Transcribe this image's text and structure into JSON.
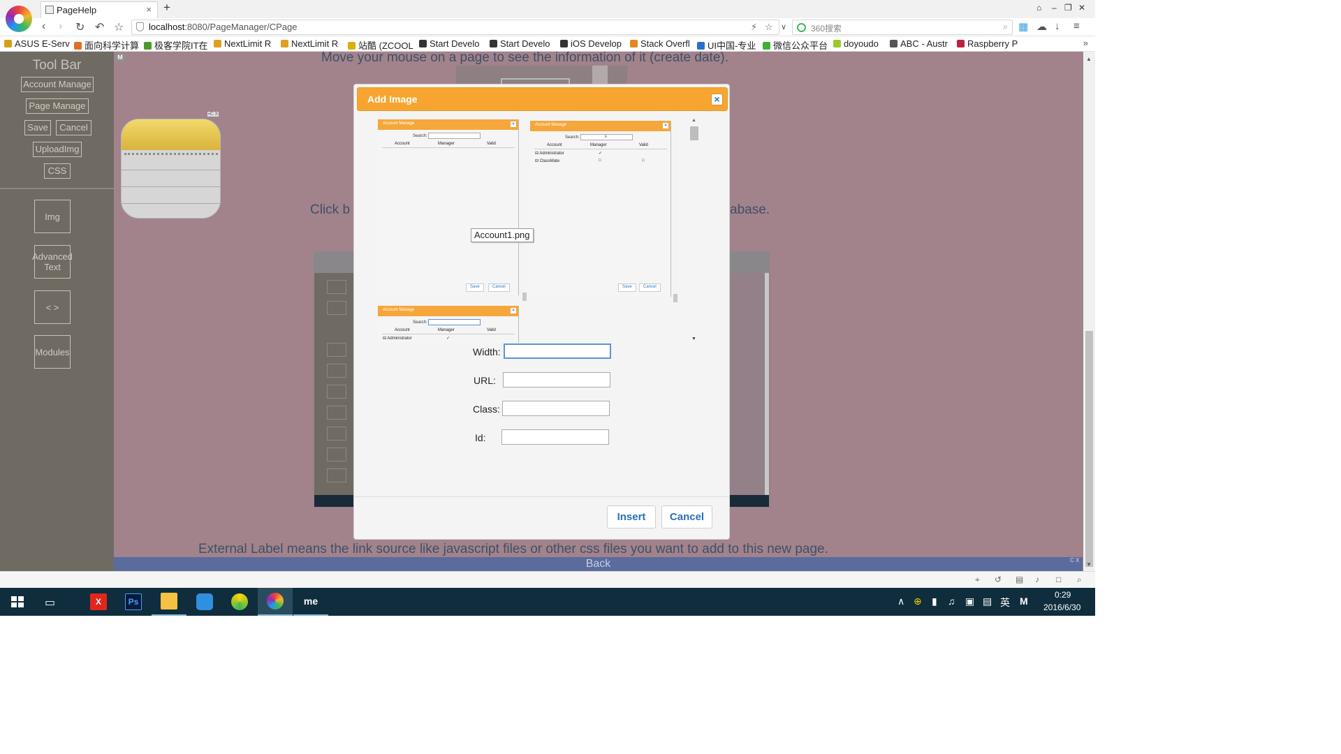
{
  "browser": {
    "tab_title": "PageHelp",
    "tab_close": "×",
    "new_tab": "+",
    "url_host": "localhost",
    "url_path": ":8080/PageManager/CPage",
    "search_placeholder": "360搜索",
    "window_controls": [
      "⌂",
      "–",
      "❐",
      "✕"
    ]
  },
  "bookmarks": [
    {
      "label": "ASUS E-Serv",
      "color": "#d4a017"
    },
    {
      "label": "面向科学计算",
      "color": "#e07020"
    },
    {
      "label": "极客学院IT在",
      "color": "#4a9a2a"
    },
    {
      "label": "NextLimit R",
      "color": "#e0a020"
    },
    {
      "label": "NextLimit R",
      "color": "#e0a020"
    },
    {
      "label": "站酷 (ZCOOL",
      "color": "#e0b000"
    },
    {
      "label": "Start Develo",
      "color": "#333333"
    },
    {
      "label": "Start Develo",
      "color": "#333333"
    },
    {
      "label": "iOS Develop",
      "color": "#333333"
    },
    {
      "label": "Stack Overfl",
      "color": "#e08a20"
    },
    {
      "label": "UI中国-专业",
      "color": "#2a6fd0"
    },
    {
      "label": "微信公众平台",
      "color": "#3cb034"
    },
    {
      "label": "doyoudo",
      "color": "#9acb2a"
    },
    {
      "label": "ABC - Austr",
      "color": "#555555"
    },
    {
      "label": "Raspberry P",
      "color": "#c02040"
    }
  ],
  "sidebar": {
    "title": "Tool Bar",
    "buttons": [
      "Account Manage",
      "Page Manage",
      "Save",
      "Cancel",
      "UploadImg",
      "CSS"
    ],
    "tools": [
      "Img",
      "Advanced Text",
      "< >",
      "Modules"
    ],
    "m_badge": "M"
  },
  "page": {
    "hint_top": "Move your mouse on a page to see the information of it (create date).",
    "hint_mid_left": "Click b",
    "hint_mid_right": "abase.",
    "hint_bottom": "External Label means the link source like javascript files or other css files you want to add to this new page.",
    "back_label": "Back",
    "notes_mini": "▪C X",
    "cx_badge": "C X"
  },
  "modal": {
    "title": "Add Image",
    "close": "×",
    "tooltip": "Account1.png",
    "preview_cards": [
      {
        "title": "Account Manage",
        "search_label": "Search:",
        "search_value": "",
        "cols": [
          "Account",
          "Manager",
          "Valid"
        ],
        "rows": [],
        "save": "Save",
        "cancel": "Cancel"
      },
      {
        "title": "Account Manage",
        "search_label": "Search:",
        "search_value": "s",
        "cols": [
          "Account",
          "Manager",
          "Valid"
        ],
        "rows": [
          "Administrator",
          "ClassMate"
        ],
        "save": "Save",
        "cancel": "Cancel"
      },
      {
        "title": "Account Manage",
        "search_label": "Search:",
        "search_value": "",
        "cols": [
          "Account",
          "Manager",
          "Valid"
        ],
        "rows": [
          "Administrator"
        ]
      }
    ],
    "fields": [
      {
        "label": "Width:",
        "value": ""
      },
      {
        "label": "URL:",
        "value": ""
      },
      {
        "label": "Class:",
        "value": ""
      },
      {
        "label": "Id:",
        "value": ""
      }
    ],
    "insert_label": "Insert",
    "cancel_label": "Cancel"
  },
  "taskbar": {
    "apps": [
      "X",
      "Ps",
      "",
      "",
      "",
      "",
      "me"
    ],
    "tray_lang": "英",
    "tray_m": "M",
    "clock_time": "0:29",
    "clock_date": "2016/6/30"
  }
}
